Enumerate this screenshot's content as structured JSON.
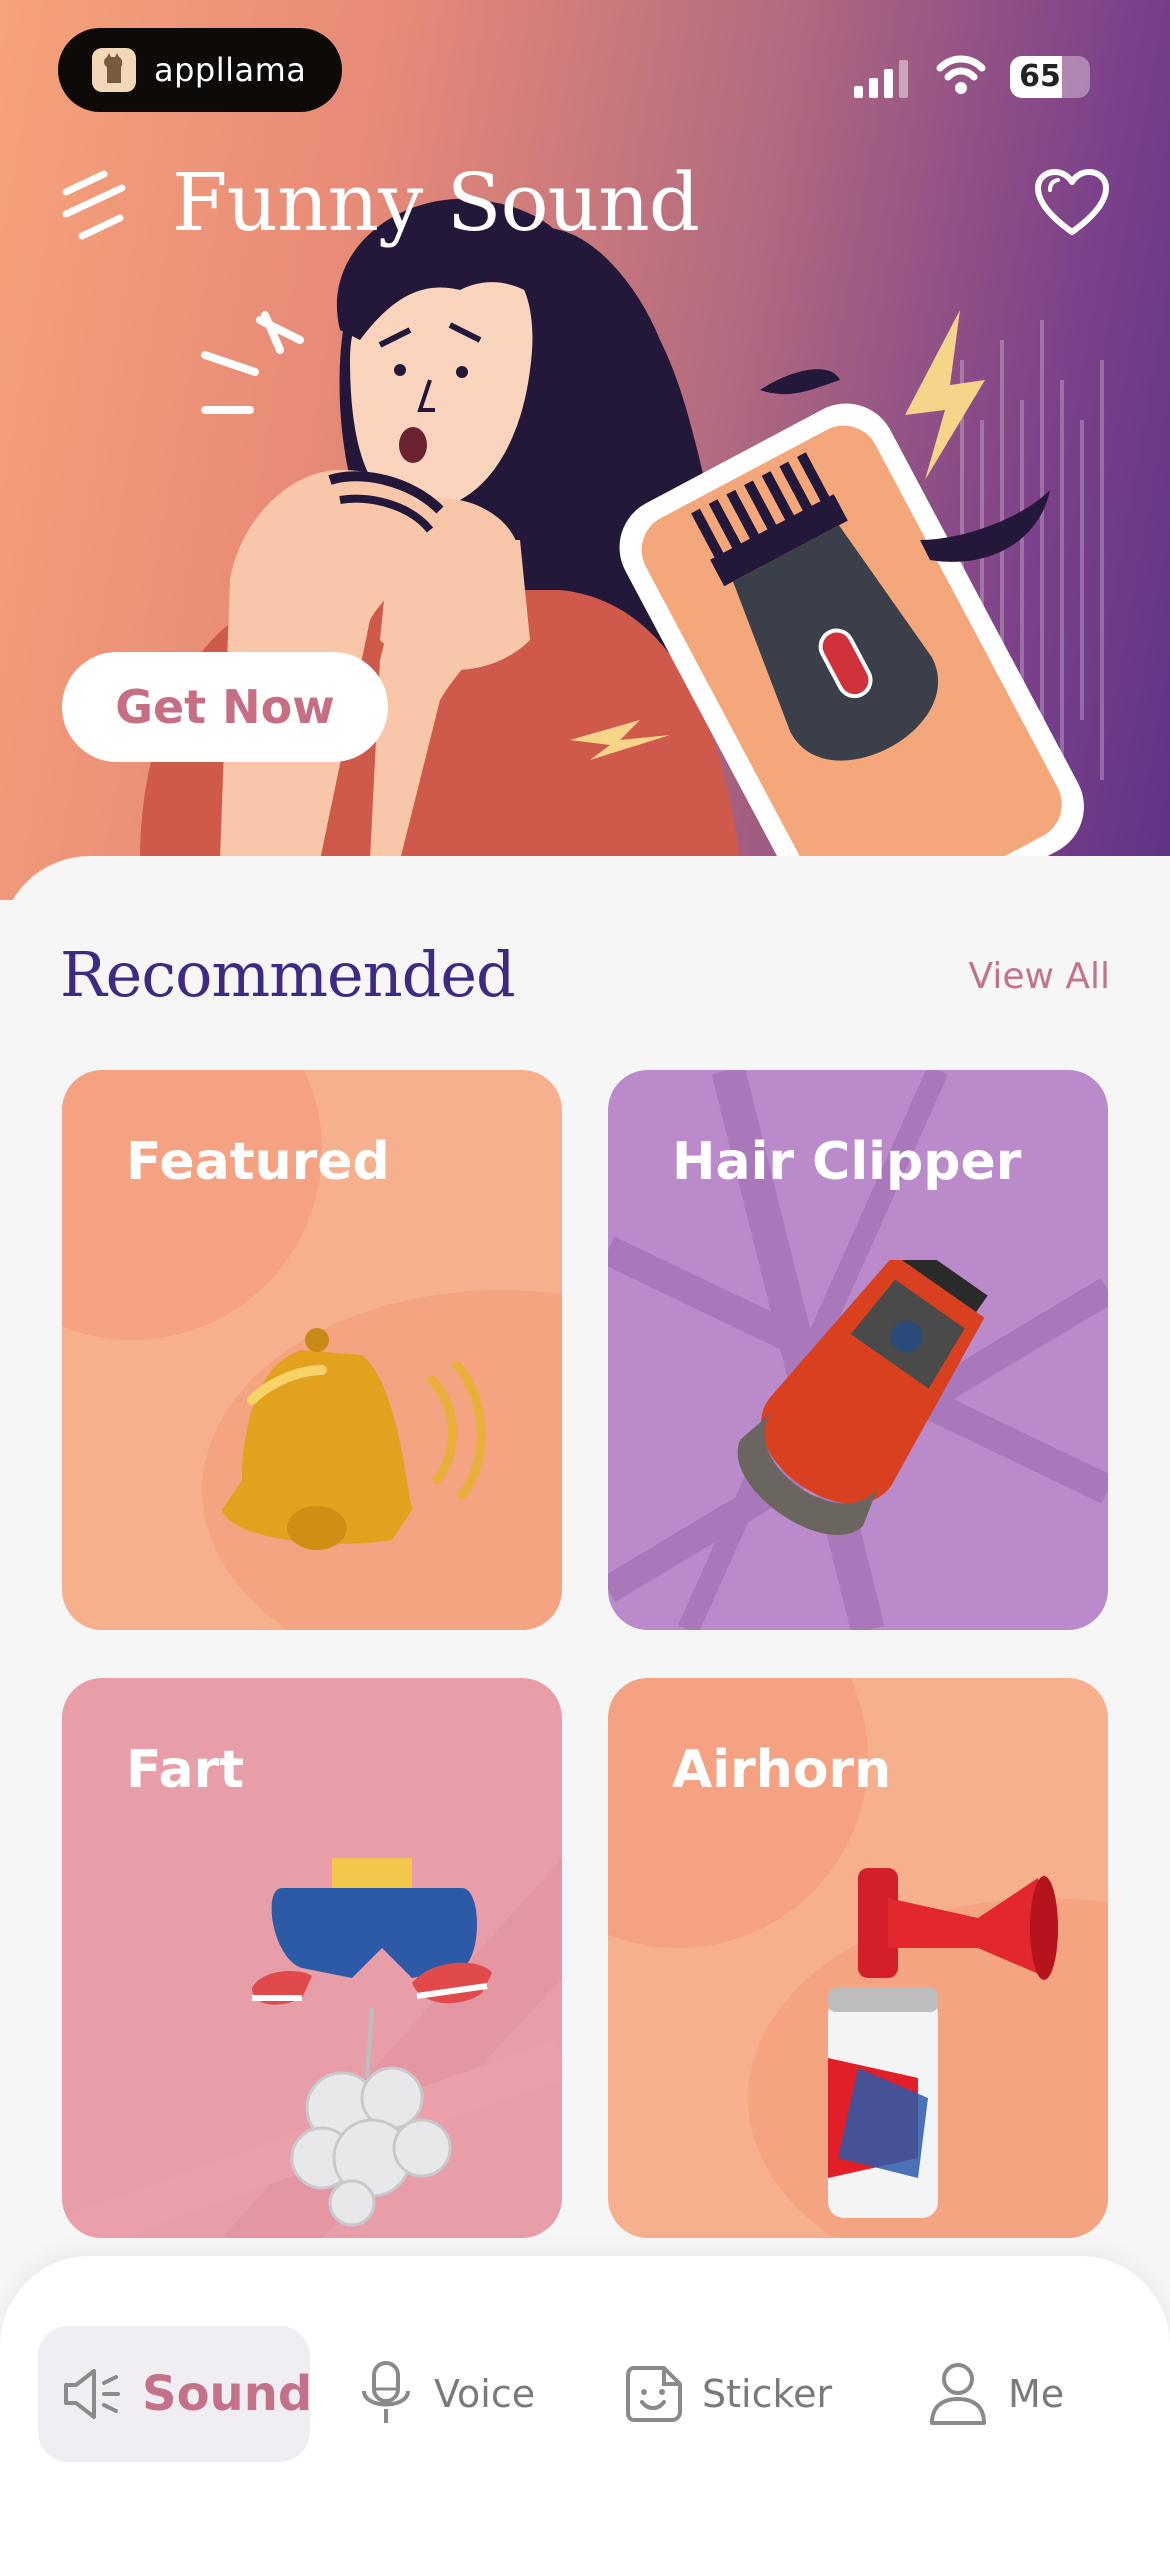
{
  "status_bar": {
    "brand": "appllama",
    "battery": "65",
    "battery_level": 0.65
  },
  "header": {
    "title": "Funny Sound",
    "cta_label": "Get Now"
  },
  "recommended": {
    "title": "Recommended",
    "view_all": "View All",
    "cards": [
      {
        "label": "Featured",
        "color": "#f6b08e"
      },
      {
        "label": "Hair Clipper",
        "color": "#bb8acb"
      },
      {
        "label": "Fart",
        "color": "#e79ea8"
      },
      {
        "label": "Airhorn",
        "color": "#f6b08e"
      }
    ]
  },
  "tabbar": {
    "items": [
      {
        "label": "Sound",
        "icon": "megaphone-icon",
        "active": true
      },
      {
        "label": "Voice",
        "icon": "microphone-icon",
        "active": false
      },
      {
        "label": "Sticker",
        "icon": "sticker-icon",
        "active": false
      },
      {
        "label": "Me",
        "icon": "user-icon",
        "active": false
      }
    ]
  },
  "colors": {
    "accent": "#c4728a",
    "title": "#3e2a82",
    "hero_start": "#f6a27a",
    "hero_end": "#5f3386"
  }
}
